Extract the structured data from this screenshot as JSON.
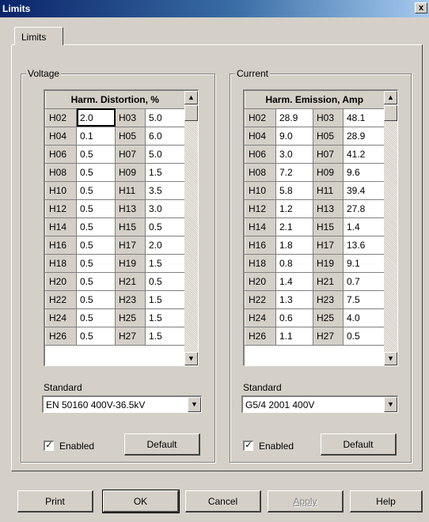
{
  "window": {
    "title": "Limits",
    "close_glyph": "x"
  },
  "tab": {
    "label": "Limits"
  },
  "voltage": {
    "group_label": "Voltage",
    "grid_header": "Harm. Distortion, %",
    "rows": [
      [
        "H02",
        "2.0",
        "H03",
        "5.0"
      ],
      [
        "H04",
        "0.1",
        "H05",
        "6.0"
      ],
      [
        "H06",
        "0.5",
        "H07",
        "5.0"
      ],
      [
        "H08",
        "0.5",
        "H09",
        "1.5"
      ],
      [
        "H10",
        "0.5",
        "H11",
        "3.5"
      ],
      [
        "H12",
        "0.5",
        "H13",
        "3.0"
      ],
      [
        "H14",
        "0.5",
        "H15",
        "0.5"
      ],
      [
        "H16",
        "0.5",
        "H17",
        "2.0"
      ],
      [
        "H18",
        "0.5",
        "H19",
        "1.5"
      ],
      [
        "H20",
        "0.5",
        "H21",
        "0.5"
      ],
      [
        "H22",
        "0.5",
        "H23",
        "1.5"
      ],
      [
        "H24",
        "0.5",
        "H25",
        "1.5"
      ],
      [
        "H26",
        "0.5",
        "H27",
        "1.5"
      ]
    ],
    "standard_label": "Standard",
    "standard_value": "EN 50160 400V-36.5kV",
    "enabled_label": "Enabled",
    "enabled_checked": true,
    "default_label": "Default"
  },
  "current": {
    "group_label": "Current",
    "grid_header": "Harm. Emission, Amp",
    "rows": [
      [
        "H02",
        "28.9",
        "H03",
        "48.1"
      ],
      [
        "H04",
        "9.0",
        "H05",
        "28.9"
      ],
      [
        "H06",
        "3.0",
        "H07",
        "41.2"
      ],
      [
        "H08",
        "7.2",
        "H09",
        "9.6"
      ],
      [
        "H10",
        "5.8",
        "H11",
        "39.4"
      ],
      [
        "H12",
        "1.2",
        "H13",
        "27.8"
      ],
      [
        "H14",
        "2.1",
        "H15",
        "1.4"
      ],
      [
        "H16",
        "1.8",
        "H17",
        "13.6"
      ],
      [
        "H18",
        "0.8",
        "H19",
        "9.1"
      ],
      [
        "H20",
        "1.4",
        "H21",
        "0.7"
      ],
      [
        "H22",
        "1.3",
        "H23",
        "7.5"
      ],
      [
        "H24",
        "0.6",
        "H25",
        "4.0"
      ],
      [
        "H26",
        "1.1",
        "H27",
        "0.5"
      ]
    ],
    "standard_label": "Standard",
    "standard_value": "G5/4 2001 400V",
    "enabled_label": "Enabled",
    "enabled_checked": true,
    "default_label": "Default"
  },
  "buttons": {
    "print": "Print",
    "ok": "OK",
    "cancel": "Cancel",
    "apply": "Apply",
    "help": "Help"
  },
  "icons": {
    "scroll_up": "▲",
    "scroll_down": "▼",
    "dropdown": "▼",
    "checkmark": "✓"
  }
}
